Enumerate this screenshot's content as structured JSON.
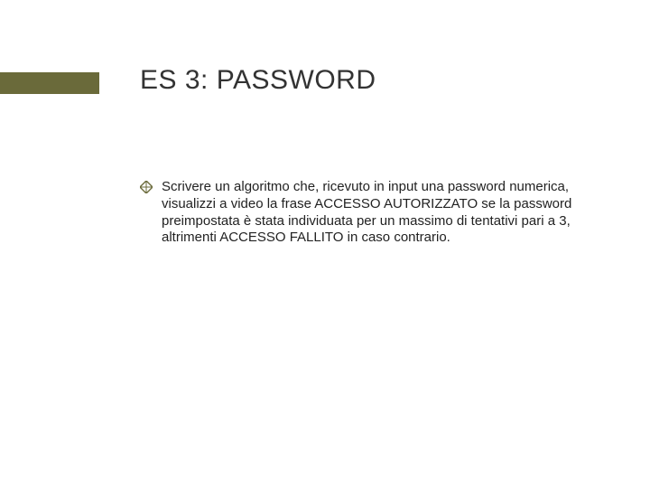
{
  "title": "ES 3: PASSWORD",
  "accent_color": "#6a6a3a",
  "bullet": {
    "icon": "diamond-icon",
    "text": "Scrivere un algoritmo che, ricevuto in input una password numerica, visualizzi a video la frase ACCESSO AUTORIZZATO se la password preimpostata è stata individuata per un massimo di tentativi pari a 3, altrimenti ACCESSO FALLITO in caso contrario."
  }
}
